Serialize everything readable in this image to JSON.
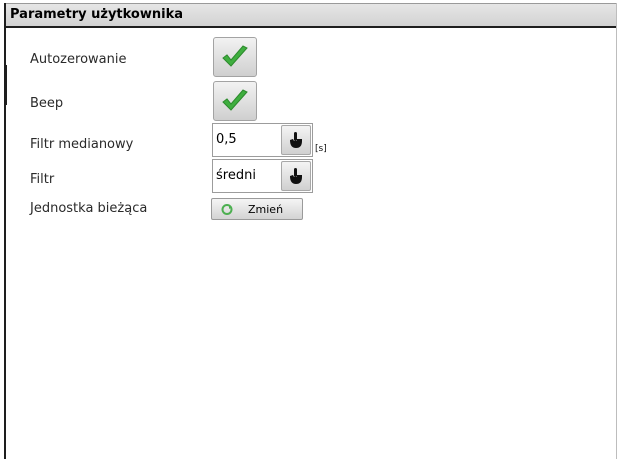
{
  "window": {
    "title": "Parametry użytkownika"
  },
  "settings": {
    "autozero": {
      "label": "Autozerowanie",
      "checked": true
    },
    "beep": {
      "label": "Beep",
      "checked": true
    },
    "median_filter": {
      "label": "Filtr medianowy",
      "value": "0,5",
      "unit": "[s]"
    },
    "filter": {
      "label": "Filtr",
      "value": "średni"
    },
    "current_unit": {
      "label": "Jednostka bieżąca",
      "button_label": "Zmień"
    }
  },
  "icons": {
    "check": "checkmark-icon",
    "dropdown": "pointer-hand-icon",
    "change": "green-arrow-icon"
  },
  "colors": {
    "check": "#3fae3f",
    "titlebar": "#d8d8d8",
    "border": "#1e1e1e"
  }
}
